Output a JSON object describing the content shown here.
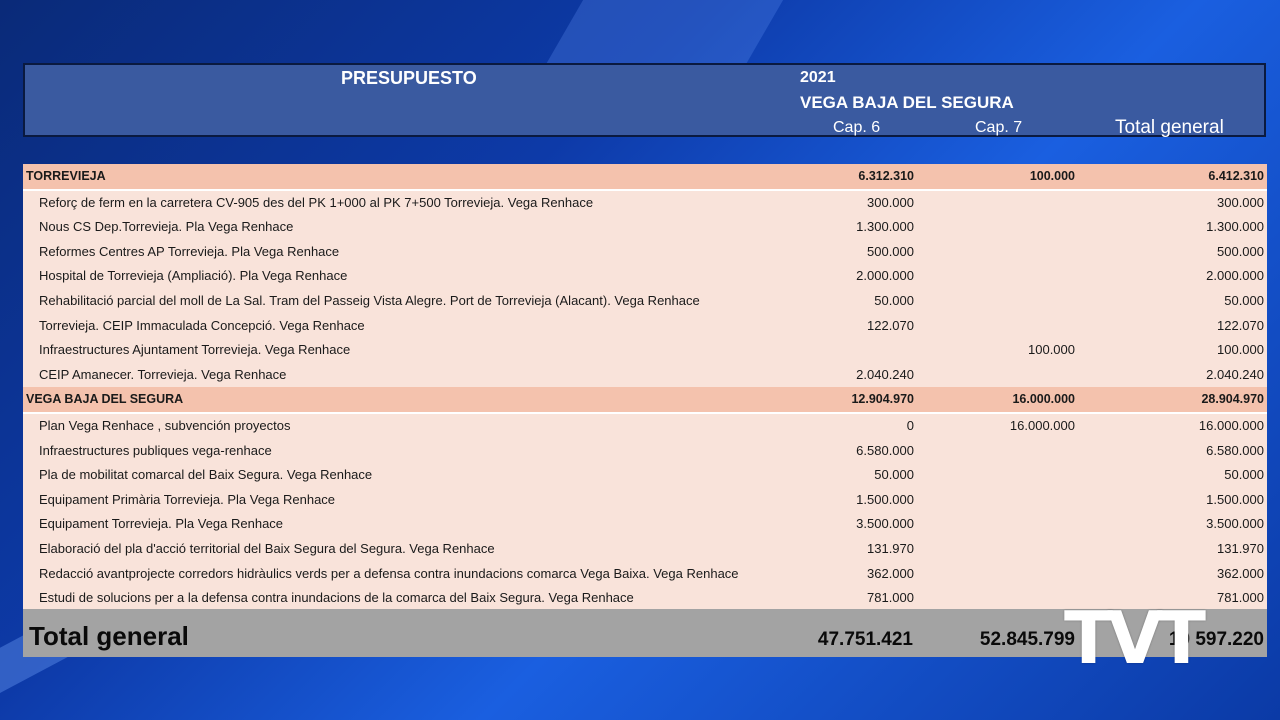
{
  "header": {
    "title": "PRESUPUESTO",
    "year": "2021",
    "region": "VEGA BAJA DEL SEGURA",
    "col_cap6": "Cap. 6",
    "col_cap7": "Cap. 7",
    "col_total": "Total general"
  },
  "rows": [
    {
      "label": "TORREVIEJA",
      "cap6": "6.312.310",
      "cap7": "100.000",
      "total": "6.412.310"
    },
    {
      "label": "Reforç de ferm en la carretera CV-905 des del PK 1+000 al PK 7+500 Torrevieja. Vega Renhace",
      "cap6": "300.000",
      "cap7": "",
      "total": "300.000"
    },
    {
      "label": "Nous CS Dep.Torrevieja. Pla Vega Renhace",
      "cap6": "1.300.000",
      "cap7": "",
      "total": "1.300.000"
    },
    {
      "label": "Reformes Centres AP Torrevieja. Pla Vega Renhace",
      "cap6": "500.000",
      "cap7": "",
      "total": "500.000"
    },
    {
      "label": "Hospital de Torrevieja (Ampliació). Pla Vega Renhace",
      "cap6": "2.000.000",
      "cap7": "",
      "total": "2.000.000"
    },
    {
      "label": "Rehabilitació parcial del moll de La Sal. Tram del Passeig Vista Alegre. Port de Torrevieja (Alacant). Vega Renhace",
      "cap6": "50.000",
      "cap7": "",
      "total": "50.000"
    },
    {
      "label": "Torrevieja. CEIP Immaculada Concepció. Vega Renhace",
      "cap6": "122.070",
      "cap7": "",
      "total": "122.070"
    },
    {
      "label": "Infraestructures Ajuntament Torrevieja. Vega Renhace",
      "cap6": "",
      "cap7": "100.000",
      "total": "100.000"
    },
    {
      "label": "CEIP Amanecer. Torrevieja. Vega Renhace",
      "cap6": "2.040.240",
      "cap7": "",
      "total": "2.040.240"
    },
    {
      "label": "VEGA BAJA DEL SEGURA",
      "cap6": "12.904.970",
      "cap7": "16.000.000",
      "total": "28.904.970"
    },
    {
      "label": "Plan Vega Renhace , subvención proyectos",
      "cap6": "0",
      "cap7": "16.000.000",
      "total": "16.000.000"
    },
    {
      "label": "Infraestructures publiques vega-renhace",
      "cap6": "6.580.000",
      "cap7": "",
      "total": "6.580.000"
    },
    {
      "label": "Pla de mobilitat comarcal del Baix Segura. Vega Renhace",
      "cap6": "50.000",
      "cap7": "",
      "total": "50.000"
    },
    {
      "label": "Equipament Primària Torrevieja. Pla Vega Renhace",
      "cap6": "1.500.000",
      "cap7": "",
      "total": "1.500.000"
    },
    {
      "label": "Equipament Torrevieja. Pla Vega Renhace",
      "cap6": "3.500.000",
      "cap7": "",
      "total": "3.500.000"
    },
    {
      "label": "Elaboració del pla d'acció territorial del Baix Segura del Segura. Vega Renhace",
      "cap6": "131.970",
      "cap7": "",
      "total": "131.970"
    },
    {
      "label": "Redacció avantprojecte corredors hidràulics verds per a defensa contra inundacions comarca Vega Baixa. Vega Renhace",
      "cap6": "362.000",
      "cap7": "",
      "total": "362.000"
    },
    {
      "label": "Estudi de solucions per a la defensa contra inundacions de la comarca del Baix Segura. Vega Renhace",
      "cap6": "781.000",
      "cap7": "",
      "total": "781.000"
    }
  ],
  "total": {
    "label": "Total general",
    "cap6": "47.751.421",
    "cap7": "52.845.799",
    "total": "10 597.220"
  },
  "logo_text": "TVT"
}
